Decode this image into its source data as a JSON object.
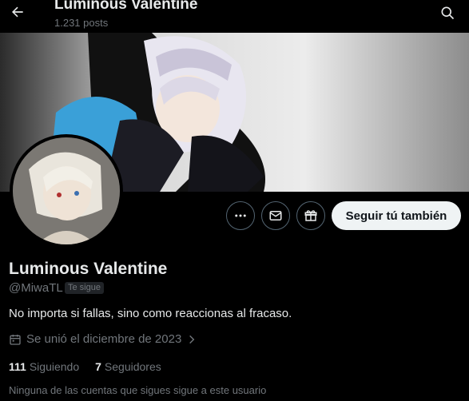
{
  "header": {
    "title": "Luminous Valentine",
    "posts": "1.231 posts"
  },
  "profile": {
    "name": "Luminous Valentine",
    "handle": "@MiwaTL",
    "follows_you_badge": "Te sigue",
    "bio": "No importa si fallas, sino como reaccionas al fracaso.",
    "joined": "Se unió el diciembre de 2023",
    "following_count": "111",
    "following_label": "Siguiendo",
    "followers_count": "7",
    "followers_label": "Seguidores",
    "mutuals_note": "Ninguna de las cuentas que sigues sigue a este usuario"
  },
  "actions": {
    "follow_back": "Seguir tú también"
  },
  "icons": [
    "back-arrow-icon",
    "search-icon",
    "more-icon",
    "message-icon",
    "gift-icon",
    "calendar-icon",
    "chevron-right-icon"
  ],
  "colors": {
    "background": "#000000",
    "text_primary": "#e7e9ea",
    "text_secondary": "#71767b",
    "button_light": "#eff3f4"
  }
}
